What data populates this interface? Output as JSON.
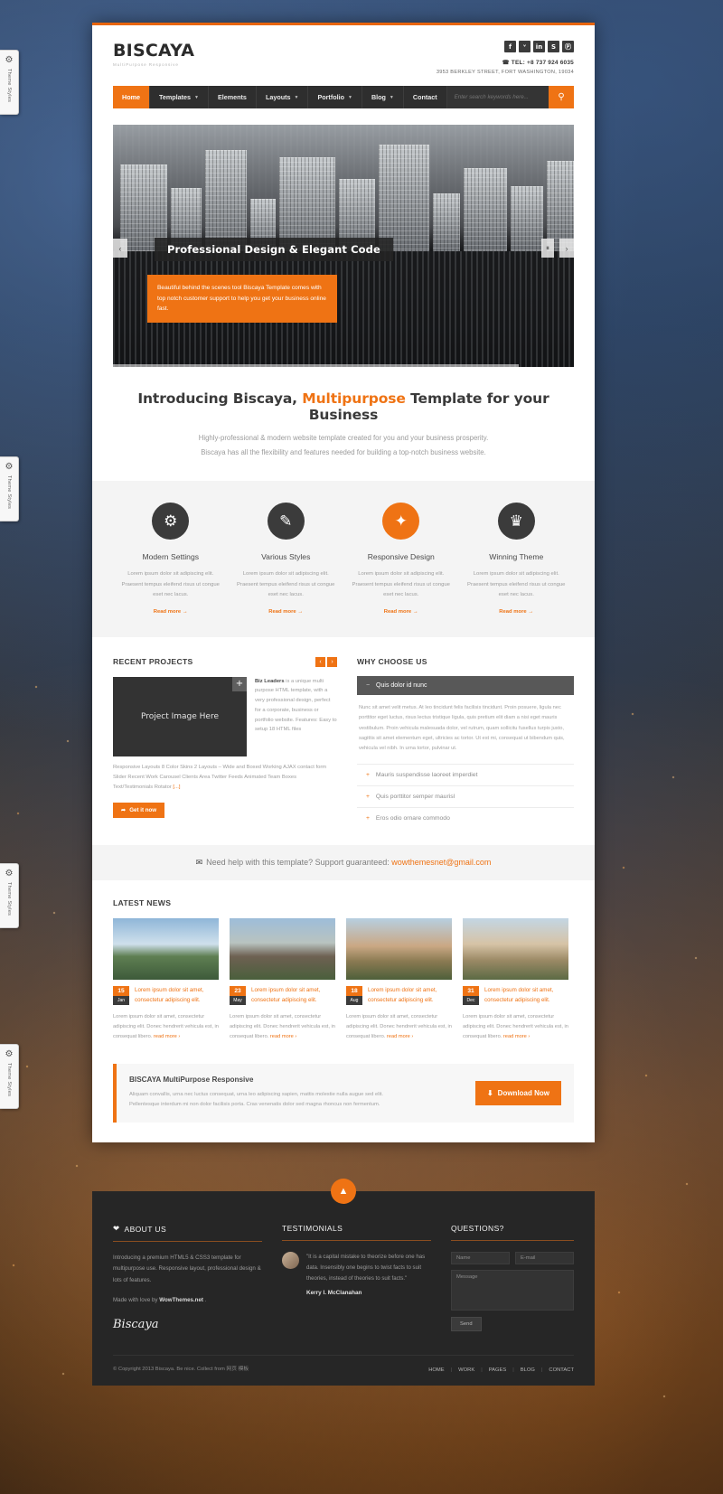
{
  "theme_tabs": [
    {
      "label": "Theme Styles"
    },
    {
      "label": "Theme Styles"
    },
    {
      "label": "Theme Styles"
    },
    {
      "label": "Theme Styles"
    }
  ],
  "header": {
    "logo": "BISCAYA",
    "logo_sub": "MultiPurpose Responsive",
    "social": [
      {
        "name": "facebook-icon",
        "glyph": "f"
      },
      {
        "name": "twitter-icon",
        "glyph": "ᵛ"
      },
      {
        "name": "linkedin-icon",
        "glyph": "in"
      },
      {
        "name": "skype-icon",
        "glyph": "S"
      },
      {
        "name": "pinterest-icon",
        "glyph": "Ⓟ"
      }
    ],
    "phone": "☎ TEL: +8 737 924 6035",
    "address": "3953 BERKLEY STREET, FORT WASHINGTON, 19034"
  },
  "nav": {
    "items": [
      {
        "label": "Home",
        "caret": false,
        "active": true
      },
      {
        "label": "Templates",
        "caret": true,
        "active": false
      },
      {
        "label": "Elements",
        "caret": false,
        "active": false
      },
      {
        "label": "Layouts",
        "caret": true,
        "active": false
      },
      {
        "label": "Portfolio",
        "caret": true,
        "active": false
      },
      {
        "label": "Blog",
        "caret": true,
        "active": false
      },
      {
        "label": "Contact",
        "caret": false,
        "active": false
      }
    ],
    "search_placeholder": "Enter search keywords here...",
    "search_icon": "search-icon"
  },
  "slider": {
    "caption": "Professional Design & Elegant Code",
    "box_text": "Beautiful behind the scenes tool Biscaya Template comes with top notch customer support to help you get your business online fast.",
    "prev": "‹",
    "next": "›",
    "pause": "⏸"
  },
  "intro": {
    "title_a": "Introducing Biscaya, ",
    "title_hl": "Multipurpose",
    "title_b": " Template for your Business",
    "line1": "Highly-professional & modern website template created for you and your business prosperity.",
    "line2": "Biscaya has all the flexibility and features needed for building a top-notch business website."
  },
  "features": [
    {
      "icon": "gears-icon",
      "glyph": "⚙",
      "title": "Modern Settings",
      "text": "Lorem ipsum dolor sit adipiscing elit. Praesent tempus eleifend risus ut congue eset nec lacus.",
      "link": "Read more →",
      "accent": false
    },
    {
      "icon": "pencil-icon",
      "glyph": "✎",
      "title": "Various Styles",
      "text": "Lorem ipsum dolor sit adipiscing elit. Praesent tempus eleifend risus ut congue eset nec lacus.",
      "link": "Read more →",
      "accent": false
    },
    {
      "icon": "magic-wand-icon",
      "glyph": "✦",
      "title": "Responsive Design",
      "text": "Lorem ipsum dolor sit adipiscing elit. Praesent tempus eleifend risus ut congue eset nec lacus.",
      "link": "Read more →",
      "accent": true
    },
    {
      "icon": "trophy-icon",
      "glyph": "♛",
      "title": "Winning Theme",
      "text": "Lorem ipsum dolor sit adipiscing elit. Praesent tempus eleifend risus ut congue eset nec lacus.",
      "link": "Read more →",
      "accent": false
    }
  ],
  "projects": {
    "heading": "RECENT PROJECTS",
    "prev": "‹",
    "next": "›",
    "image_label": "Project Image Here",
    "plus": "+",
    "lead": "Biz Leaders",
    "body": " is a unique multi purpose HTML template, with a very professional design, perfect for a corporate, business or portfolio website. Features: Easy to setup 18 HTML files",
    "more": "Responsive Layouts 8 Color Skins 2 Layouts – Wide and Boxed Working AJAX contact form Slider Recent Work Carousel Clients Area Twitter Feeds Animated Team Boxes Text/Testimonials Rotator",
    "more_link": "[...]",
    "button": "Get it now"
  },
  "why": {
    "heading": "WHY CHOOSE US",
    "open_title": "Quis dolor id nunc",
    "open_body": "Nunc sit amet velit metus. At leo tincidunt felis facilisis tincidunt. Proin posuere, ligula nec porttitor eget luctus, risus lectus tristique ligula, quis pretium elit diam a nisi eget mauris vestibulum. Proin vehicula malesuada dolor, vel rutrum, quam sollicitu fusellus turpis justo, sagittis sit amet elementum eget, ultricies ac tortor. Ut est mi, consequat ut bibendum quis, vehicula vel nibh. In urna tortor, pulvinar ut.",
    "items": [
      {
        "label": "Mauris suspendisse laoreet imperdiet"
      },
      {
        "label": "Quis porttitor semper maurisl"
      },
      {
        "label": "Eros odio ornare commodo"
      }
    ]
  },
  "support": {
    "text": "Need help with this template? Support guaranteed: ",
    "email": "wowthemesnet@gmail.com",
    "icon": "envelope-icon"
  },
  "news": {
    "heading": "LATEST NEWS",
    "items": [
      {
        "day": "15",
        "month": "Jan",
        "title": "Lorem ipsum dolor sit amet, consectetur adipiscing elit.",
        "body": "Lorem ipsum dolor sit amet, consectetur adipiscing elit. Donec hendrerit vehicula est, in consequat libero. ",
        "readmore": "read more ›"
      },
      {
        "day": "23",
        "month": "May",
        "title": "Lorem ipsum dolor sit amet, consectetur adipiscing elit.",
        "body": "Lorem ipsum dolor sit amet, consectetur adipiscing elit. Donec hendrerit vehicula est, in consequat libero. ",
        "readmore": "read more ›"
      },
      {
        "day": "18",
        "month": "Aug",
        "title": "Lorem ipsum dolor sit amet, consectetur adipiscing elit.",
        "body": "Lorem ipsum dolor sit amet, consectetur adipiscing elit. Donec hendrerit vehicula est, in consequat libero. ",
        "readmore": "read more ›"
      },
      {
        "day": "31",
        "month": "Dec",
        "title": "Lorem ipsum dolor sit amet, consectetur adipiscing elit.",
        "body": "Lorem ipsum dolor sit amet, consectetur adipiscing elit. Donec hendrerit vehicula est, in consequat libero. ",
        "readmore": "read more ›"
      }
    ]
  },
  "cta": {
    "title": "BISCAYA MultiPurpose Responsive",
    "line1": "Aliquam convallis, urna nec luctus consequat, urna leo adipiscing sapien, mattis molestie nulla augue sed elit.",
    "line2": "Pellentesque interdum mi non dolor facilisis porta. Cras venenatis dolor sed magna rhoncus non fermentum.",
    "button": "Download Now",
    "button_icon": "download-icon"
  },
  "footer": {
    "to_top_icon": "chevron-up-icon",
    "about": {
      "heading": "ABOUT US",
      "heart_icon": "heart-icon",
      "p1": "Introducing a premium HTML5 & CSS3 template for multipurpose use. Responsive layout, professional design & lots of features.",
      "p2_pre": "Made with love by ",
      "p2_link": "WowThemes.net",
      "p2_post": " .",
      "script_logo": "Biscaya"
    },
    "testimonials": {
      "heading": "TESTIMONIALS",
      "quote": "\"It is a capital mistake to theorize before one has data. Insensibly one begins to twist facts to suit theories, instead of theories to suit facts.\"",
      "author": "Kerry I. McClanahan"
    },
    "questions": {
      "heading": "QUESTIONS?",
      "name_placeholder": "Name",
      "email_placeholder": "E-mail",
      "message_placeholder": "Message",
      "send_label": "Send"
    },
    "copyright": "© Copyright 2013 Biscaya. Be nice. Collect from 网页 模板",
    "links": [
      "HOME",
      "WORK",
      "PAGES",
      "BLOG",
      "CONTACT"
    ]
  }
}
